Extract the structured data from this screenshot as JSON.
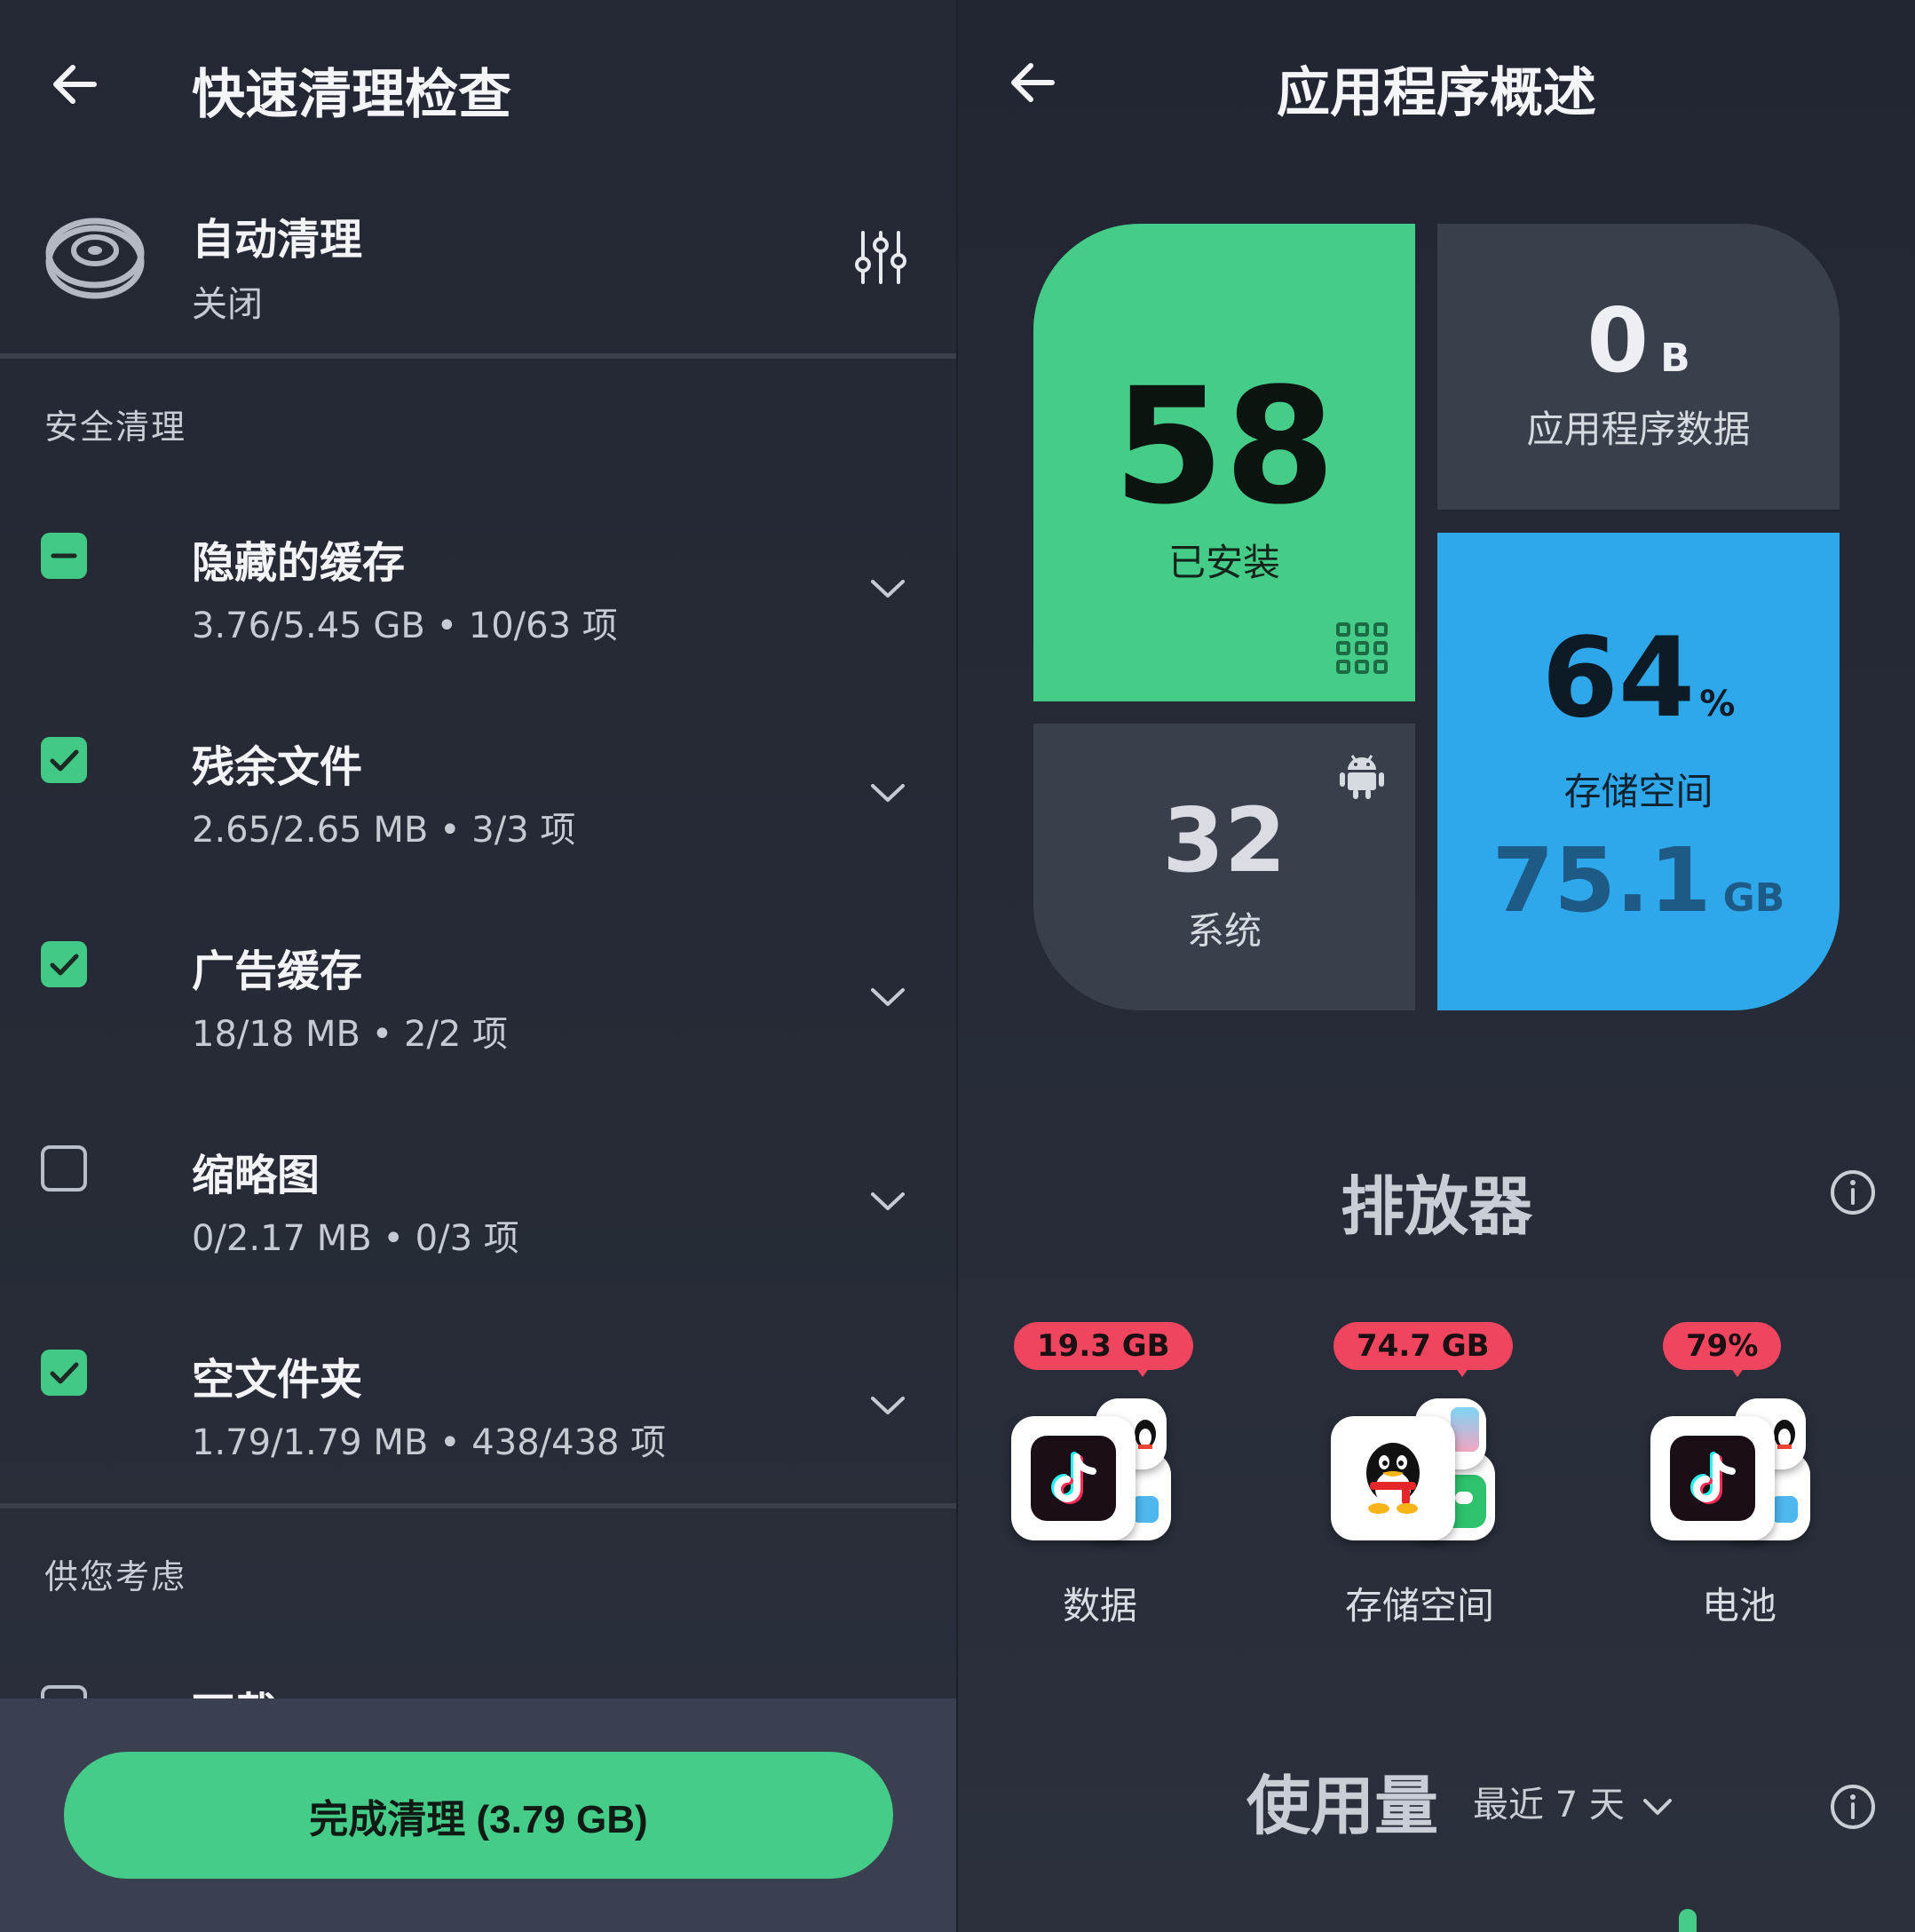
{
  "left": {
    "title": "快速清理检查",
    "auto_clean": {
      "title": "自动清理",
      "status": "关闭"
    },
    "section_safe": "安全清理",
    "items": [
      {
        "title": "隐藏的缓存",
        "detail": "3.76/5.45 GB • 10/63 项",
        "state": "partial"
      },
      {
        "title": "残余文件",
        "detail": "2.65/2.65 MB • 3/3 项",
        "state": "checked"
      },
      {
        "title": "广告缓存",
        "detail": "18/18 MB • 2/2 项",
        "state": "checked"
      },
      {
        "title": "缩略图",
        "detail": "0/2.17 MB • 0/3 项",
        "state": "unchecked"
      },
      {
        "title": "空文件夹",
        "detail": "1.79/1.79 MB • 438/438 项",
        "state": "checked"
      }
    ],
    "section_consider": "供您考虑",
    "peek_item": "下载",
    "finish_button": "完成清理 (3.79 GB)"
  },
  "right": {
    "title": "应用程序概述",
    "installed": {
      "value": "58",
      "label": "已安装"
    },
    "app_data": {
      "value": "0",
      "unit": "B",
      "label": "应用程序数据"
    },
    "system": {
      "value": "32",
      "label": "系统"
    },
    "storage": {
      "percent": "64",
      "percent_unit": "%",
      "label": "存储空间",
      "value": "75.1",
      "unit": "GB"
    },
    "drainers_title": "排放器",
    "drainers": [
      {
        "badge": "19.3 GB",
        "label": "数据",
        "app": "tiktok-icon"
      },
      {
        "badge": "74.7 GB",
        "label": "存储空间",
        "app": "qq-icon"
      },
      {
        "badge": "79%",
        "label": "电池",
        "app": "tiktok-icon"
      }
    ],
    "usage_title": "使用量",
    "usage_period": "最近 7 天"
  },
  "colors": {
    "accent_green": "#45cc88",
    "storage_blue": "#2ea8ea",
    "badge_red": "#f0455e",
    "tile_gray": "#3a3f4c",
    "background": "#262b36"
  }
}
